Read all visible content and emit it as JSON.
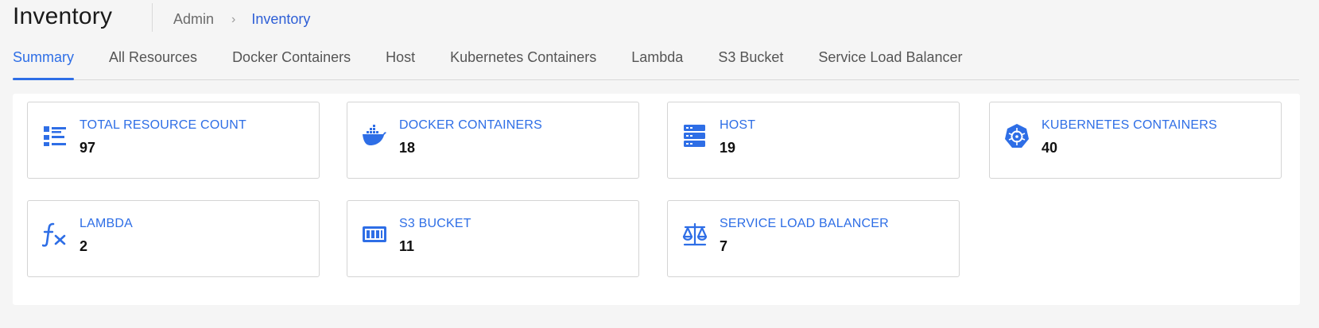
{
  "page": {
    "title": "Inventory"
  },
  "breadcrumb": {
    "parent": "Admin",
    "current": "Inventory"
  },
  "tabs": [
    {
      "label": "Summary",
      "active": true
    },
    {
      "label": "All Resources",
      "active": false
    },
    {
      "label": "Docker Containers",
      "active": false
    },
    {
      "label": "Host",
      "active": false
    },
    {
      "label": "Kubernetes Containers",
      "active": false
    },
    {
      "label": "Lambda",
      "active": false
    },
    {
      "label": "S3 Bucket",
      "active": false
    },
    {
      "label": "Service Load Balancer",
      "active": false
    }
  ],
  "cards": [
    {
      "label": "TOTAL RESOURCE COUNT",
      "count": "97",
      "icon": "list-icon"
    },
    {
      "label": "DOCKER CONTAINERS",
      "count": "18",
      "icon": "docker-icon"
    },
    {
      "label": "HOST",
      "count": "19",
      "icon": "server-icon"
    },
    {
      "label": "KUBERNETES CONTAINERS",
      "count": "40",
      "icon": "kubernetes-icon"
    },
    {
      "label": "LAMBDA",
      "count": "2",
      "icon": "function-icon"
    },
    {
      "label": "S3 BUCKET",
      "count": "11",
      "icon": "bucket-icon"
    },
    {
      "label": "SERVICE LOAD BALANCER",
      "count": "7",
      "icon": "scale-icon"
    }
  ],
  "colors": {
    "accent": "#2e6ee6",
    "background": "#f5f5f5",
    "card_border": "#d4d4d4"
  }
}
